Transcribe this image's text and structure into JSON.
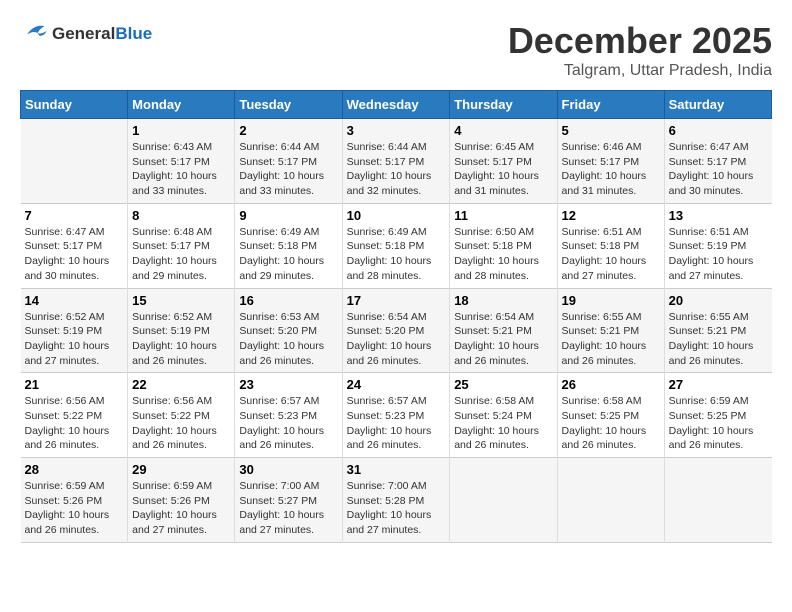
{
  "logo": {
    "general": "General",
    "blue": "Blue"
  },
  "title": "December 2025",
  "location": "Talgram, Uttar Pradesh, India",
  "weekdays": [
    "Sunday",
    "Monday",
    "Tuesday",
    "Wednesday",
    "Thursday",
    "Friday",
    "Saturday"
  ],
  "rows": [
    [
      {
        "day": "",
        "info": ""
      },
      {
        "day": "1",
        "info": "Sunrise: 6:43 AM\nSunset: 5:17 PM\nDaylight: 10 hours\nand 33 minutes."
      },
      {
        "day": "2",
        "info": "Sunrise: 6:44 AM\nSunset: 5:17 PM\nDaylight: 10 hours\nand 33 minutes."
      },
      {
        "day": "3",
        "info": "Sunrise: 6:44 AM\nSunset: 5:17 PM\nDaylight: 10 hours\nand 32 minutes."
      },
      {
        "day": "4",
        "info": "Sunrise: 6:45 AM\nSunset: 5:17 PM\nDaylight: 10 hours\nand 31 minutes."
      },
      {
        "day": "5",
        "info": "Sunrise: 6:46 AM\nSunset: 5:17 PM\nDaylight: 10 hours\nand 31 minutes."
      },
      {
        "day": "6",
        "info": "Sunrise: 6:47 AM\nSunset: 5:17 PM\nDaylight: 10 hours\nand 30 minutes."
      }
    ],
    [
      {
        "day": "7",
        "info": "Sunrise: 6:47 AM\nSunset: 5:17 PM\nDaylight: 10 hours\nand 30 minutes."
      },
      {
        "day": "8",
        "info": "Sunrise: 6:48 AM\nSunset: 5:17 PM\nDaylight: 10 hours\nand 29 minutes."
      },
      {
        "day": "9",
        "info": "Sunrise: 6:49 AM\nSunset: 5:18 PM\nDaylight: 10 hours\nand 29 minutes."
      },
      {
        "day": "10",
        "info": "Sunrise: 6:49 AM\nSunset: 5:18 PM\nDaylight: 10 hours\nand 28 minutes."
      },
      {
        "day": "11",
        "info": "Sunrise: 6:50 AM\nSunset: 5:18 PM\nDaylight: 10 hours\nand 28 minutes."
      },
      {
        "day": "12",
        "info": "Sunrise: 6:51 AM\nSunset: 5:18 PM\nDaylight: 10 hours\nand 27 minutes."
      },
      {
        "day": "13",
        "info": "Sunrise: 6:51 AM\nSunset: 5:19 PM\nDaylight: 10 hours\nand 27 minutes."
      }
    ],
    [
      {
        "day": "14",
        "info": "Sunrise: 6:52 AM\nSunset: 5:19 PM\nDaylight: 10 hours\nand 27 minutes."
      },
      {
        "day": "15",
        "info": "Sunrise: 6:52 AM\nSunset: 5:19 PM\nDaylight: 10 hours\nand 26 minutes."
      },
      {
        "day": "16",
        "info": "Sunrise: 6:53 AM\nSunset: 5:20 PM\nDaylight: 10 hours\nand 26 minutes."
      },
      {
        "day": "17",
        "info": "Sunrise: 6:54 AM\nSunset: 5:20 PM\nDaylight: 10 hours\nand 26 minutes."
      },
      {
        "day": "18",
        "info": "Sunrise: 6:54 AM\nSunset: 5:21 PM\nDaylight: 10 hours\nand 26 minutes."
      },
      {
        "day": "19",
        "info": "Sunrise: 6:55 AM\nSunset: 5:21 PM\nDaylight: 10 hours\nand 26 minutes."
      },
      {
        "day": "20",
        "info": "Sunrise: 6:55 AM\nSunset: 5:21 PM\nDaylight: 10 hours\nand 26 minutes."
      }
    ],
    [
      {
        "day": "21",
        "info": "Sunrise: 6:56 AM\nSunset: 5:22 PM\nDaylight: 10 hours\nand 26 minutes."
      },
      {
        "day": "22",
        "info": "Sunrise: 6:56 AM\nSunset: 5:22 PM\nDaylight: 10 hours\nand 26 minutes."
      },
      {
        "day": "23",
        "info": "Sunrise: 6:57 AM\nSunset: 5:23 PM\nDaylight: 10 hours\nand 26 minutes."
      },
      {
        "day": "24",
        "info": "Sunrise: 6:57 AM\nSunset: 5:23 PM\nDaylight: 10 hours\nand 26 minutes."
      },
      {
        "day": "25",
        "info": "Sunrise: 6:58 AM\nSunset: 5:24 PM\nDaylight: 10 hours\nand 26 minutes."
      },
      {
        "day": "26",
        "info": "Sunrise: 6:58 AM\nSunset: 5:25 PM\nDaylight: 10 hours\nand 26 minutes."
      },
      {
        "day": "27",
        "info": "Sunrise: 6:59 AM\nSunset: 5:25 PM\nDaylight: 10 hours\nand 26 minutes."
      }
    ],
    [
      {
        "day": "28",
        "info": "Sunrise: 6:59 AM\nSunset: 5:26 PM\nDaylight: 10 hours\nand 26 minutes."
      },
      {
        "day": "29",
        "info": "Sunrise: 6:59 AM\nSunset: 5:26 PM\nDaylight: 10 hours\nand 27 minutes."
      },
      {
        "day": "30",
        "info": "Sunrise: 7:00 AM\nSunset: 5:27 PM\nDaylight: 10 hours\nand 27 minutes."
      },
      {
        "day": "31",
        "info": "Sunrise: 7:00 AM\nSunset: 5:28 PM\nDaylight: 10 hours\nand 27 minutes."
      },
      {
        "day": "",
        "info": ""
      },
      {
        "day": "",
        "info": ""
      },
      {
        "day": "",
        "info": ""
      }
    ]
  ]
}
